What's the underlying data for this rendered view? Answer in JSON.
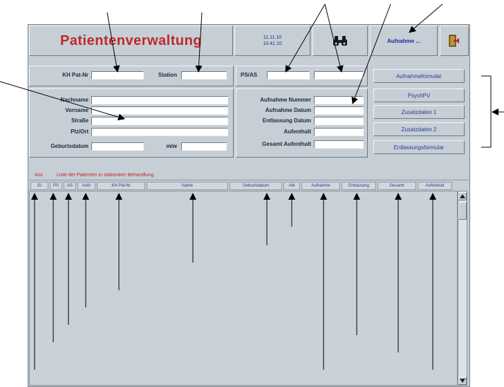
{
  "header": {
    "title": "Patientenverwaltung",
    "date": "11.11.10",
    "time": "10.41.10",
    "search_icon": "binoculars-icon",
    "admission_button_label": "Aufnahme ...",
    "exit_icon": "exit-door-icon"
  },
  "top_fields": {
    "kh_patnr_label": "KH Pat-Nr",
    "station_label": "Station",
    "ps_as_label": "PS/AS"
  },
  "person": {
    "nachname_label": "Nachname",
    "vorname_label": "Vorname",
    "strasse_label": "Straße",
    "plzort_label": "Plz/Ort",
    "geburtsdatum_label": "Geburtsdatum",
    "mw_label": "m/w"
  },
  "admission": {
    "nummer_label": "Aufnahme Nummer",
    "datum_label": "Aufnahme Datum",
    "entlassung_label": "Entlassung Datum",
    "aufenthalt_label": "Aufenthalt",
    "gesamt_label": "Gesamt Aufenthalt"
  },
  "side_buttons": [
    "Aufnahmeformular",
    "PsychPV",
    "Zusatzdaten 1",
    "Zusatzdaten 2",
    "Entlassungsformular"
  ],
  "list": {
    "tag": "Ass",
    "caption": "Liste der Patienten in stationärer Behandlung",
    "columns": [
      "ID",
      "PS",
      "AS",
      "Aufn",
      "KH Pat-Nr",
      "Name",
      "Geburtsdatum",
      "Abt",
      "Aufnahme",
      "Entlassung",
      "Gesamt",
      "Aufenthalt"
    ]
  }
}
